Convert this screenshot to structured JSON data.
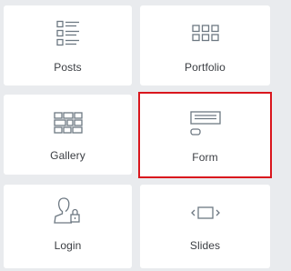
{
  "widgets": [
    {
      "label": "Posts",
      "icon": "posts-list-icon",
      "selected": false
    },
    {
      "label": "Portfolio",
      "icon": "portfolio-grid-icon",
      "selected": false
    },
    {
      "label": "Gallery",
      "icon": "gallery-grid-icon",
      "selected": false
    },
    {
      "label": "Form",
      "icon": "form-icon",
      "selected": true
    },
    {
      "label": "Login",
      "icon": "login-user-lock-icon",
      "selected": false
    },
    {
      "label": "Slides",
      "icon": "slides-icon",
      "selected": false
    }
  ],
  "colors": {
    "background": "#e9ebee",
    "card": "#ffffff",
    "icon_stroke": "#6d7882",
    "text": "#3a3d42",
    "selection_border": "#d9161d"
  }
}
